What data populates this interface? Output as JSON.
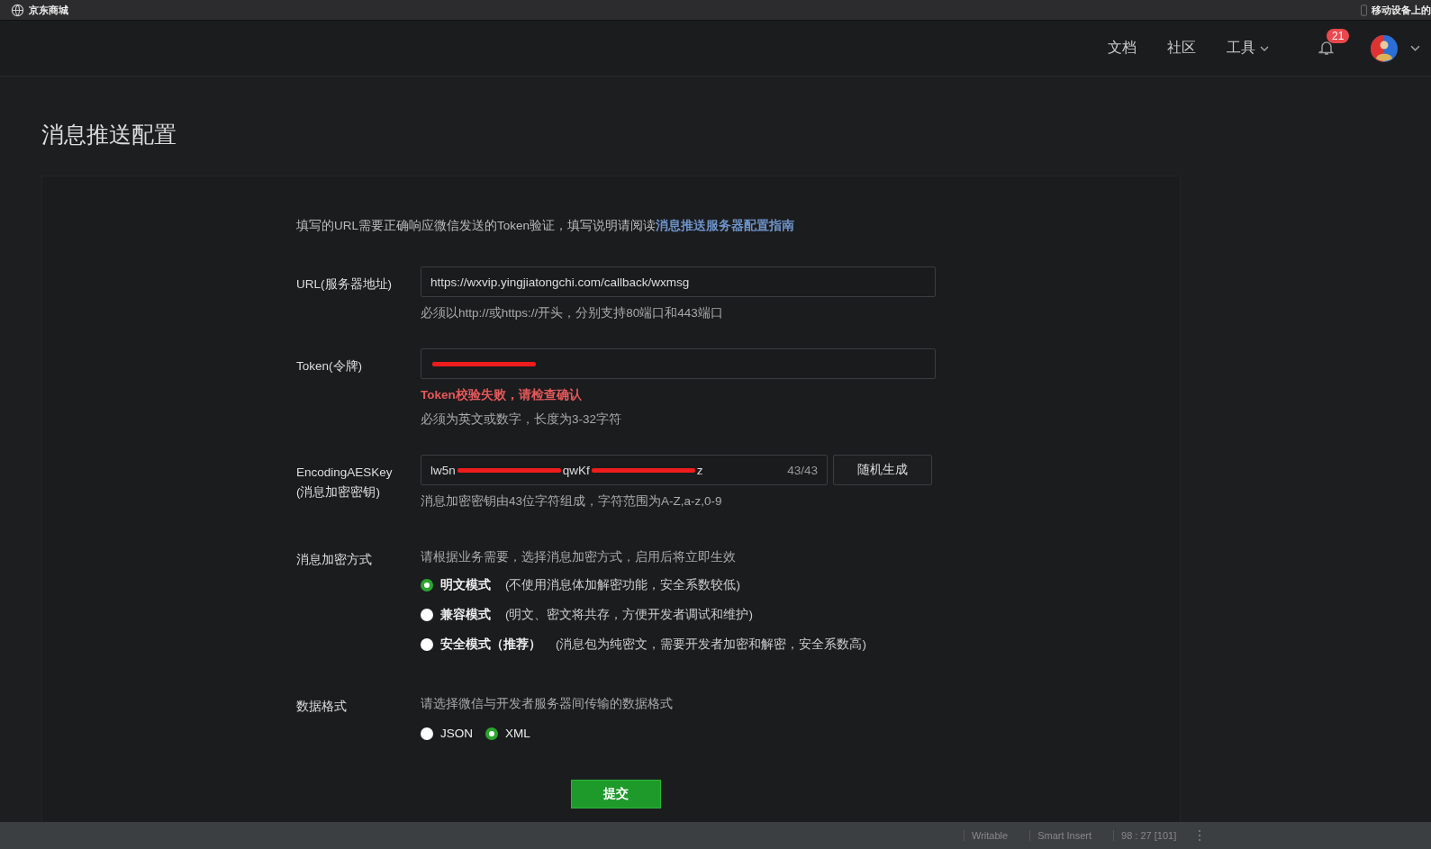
{
  "browser_bar": {
    "site": "京东商城",
    "right_text": "移动设备上的"
  },
  "nav": {
    "links": [
      {
        "label": "文档",
        "dropdown": false
      },
      {
        "label": "社区",
        "dropdown": false
      },
      {
        "label": "工具",
        "dropdown": true
      }
    ],
    "notification_count": "21"
  },
  "page_title": "消息推送配置",
  "intro": {
    "text": "填写的URL需要正确响应微信发送的Token验证，填写说明请阅读",
    "link": "消息推送服务器配置指南"
  },
  "fields": [
    {
      "kind": "text",
      "label": "URL(服务器地址)",
      "segments": [
        {
          "text": "https://wxvip.yingjiatongchi.com/callback/wxmsg"
        }
      ],
      "hint": "必须以http://或https://开头，分别支持80端口和443端口"
    },
    {
      "kind": "text",
      "label": "Token(令牌)",
      "segments": [
        {
          "kind": "redaction"
        }
      ],
      "error": "Token校验失败，请检查确认",
      "hint": "必须为英文或数字，长度为3-32字符"
    },
    {
      "kind": "key",
      "label": "EncodingAESKey",
      "sublabel": "(消息加密密钥)",
      "segments": [
        {
          "text": "lw5n"
        },
        {
          "kind": "redaction"
        },
        {
          "text": "qwKf"
        },
        {
          "kind": "redaction"
        },
        {
          "text": "z"
        }
      ],
      "counter": "43/43",
      "button": "随机生成",
      "hint": "消息加密密钥由43位字符组成，字符范围为A-Z,a-z,0-9"
    },
    {
      "kind": "radio",
      "label": "消息加密方式",
      "hint": "请根据业务需要，选择消息加密方式，启用后将立即生效",
      "options": [
        {
          "label": "明文模式",
          "note": "(不使用消息体加解密功能，安全系数较低)",
          "selected": true
        },
        {
          "label": "兼容模式",
          "note": "(明文、密文将共存，方便开发者调试和维护)",
          "selected": false
        },
        {
          "label": "安全模式（推荐）",
          "note": "(消息包为纯密文，需要开发者加密和解密，安全系数高)",
          "selected": false
        }
      ]
    },
    {
      "kind": "inline_radio",
      "label": "数据格式",
      "hint": "请选择微信与开发者服务器间传输的数据格式",
      "options": [
        {
          "label": "JSON",
          "selected": false
        },
        {
          "label": "XML",
          "selected": true
        }
      ]
    }
  ],
  "submit": "提交",
  "status_bar": [
    "Writable",
    "Smart Insert",
    "98 : 27 [101]"
  ]
}
